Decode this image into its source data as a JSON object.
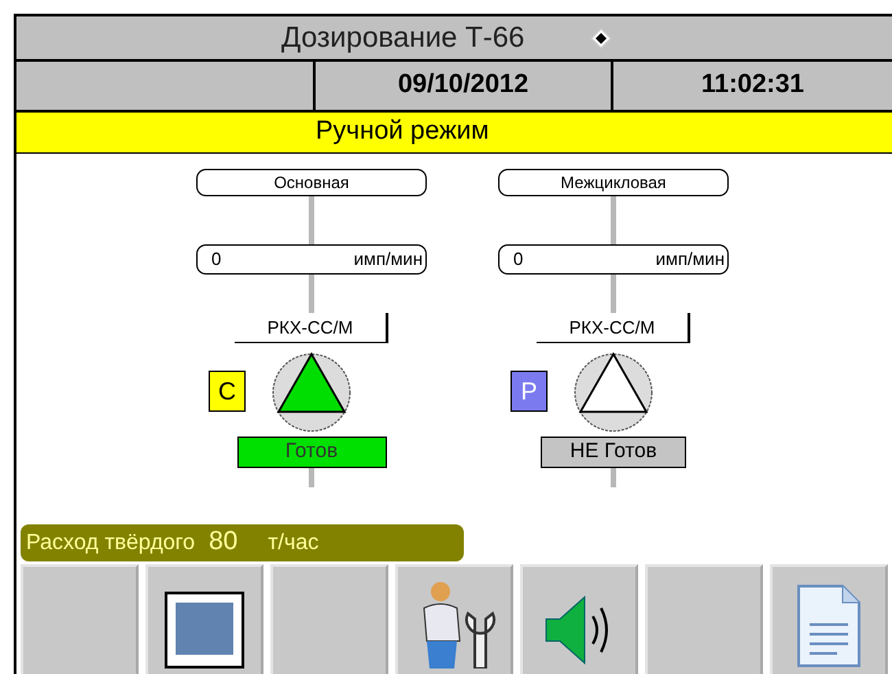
{
  "window": {
    "title": "Дозирование Т-66"
  },
  "header": {
    "date": "09/10/2012",
    "time": "11:02:31"
  },
  "mode_banner": "Ручной режим",
  "lines": [
    {
      "name": "Основная",
      "rate": "0",
      "rate_unit": "имп/мин",
      "device": "РКХ-СС/М",
      "mode_letter": "С",
      "color": "#ffff00",
      "running": true,
      "status": "Готов",
      "ready": true
    },
    {
      "name": "Межцикловая",
      "rate": "0",
      "rate_unit": "имп/мин",
      "device": "РКХ-СС/М",
      "mode_letter": "Р",
      "color": "#7b7bef",
      "running": false,
      "status": "НЕ Готов",
      "ready": false
    }
  ],
  "flow": {
    "label": "Расход твёрдого",
    "value": "80",
    "unit": "т/час"
  },
  "toolbar": [
    {
      "kind": "blank"
    },
    {
      "kind": "screen"
    },
    {
      "kind": "blank"
    },
    {
      "kind": "service"
    },
    {
      "kind": "sound"
    },
    {
      "kind": "blank"
    },
    {
      "kind": "document"
    }
  ]
}
